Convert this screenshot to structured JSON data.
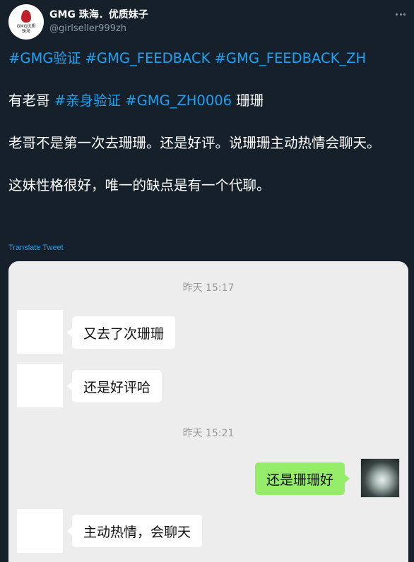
{
  "user": {
    "name": "GMG 珠海．优质妹子",
    "handle": "@girlseller999zh",
    "avatar_text": [
      "GMG优质",
      "珠海"
    ]
  },
  "tweet": {
    "hashtags_line": [
      "#GMG验证",
      "#GMG_FEEDBACK",
      "#GMG_FEEDBACK_ZH"
    ],
    "line2": {
      "prefix": "有老哥",
      "tag1": "#亲身验证",
      "tag2": "#GMG_ZH0006",
      "suffix": "珊珊"
    },
    "para2": "老哥不是第一次去珊珊。还是好评。说珊珊主动热情会聊天。",
    "para3": "这妹性格很好，唯一的缺点是有一个代聊。",
    "translate": "Translate Tweet"
  },
  "chat": {
    "timestamp1": "昨天 15:17",
    "msg1": "又去了次珊珊",
    "msg2": "还是好评哈",
    "timestamp2": "昨天 15:21",
    "msg3": "还是珊珊好",
    "msg4": "主动热情，会聊天"
  },
  "colors": {
    "background": "#15202b",
    "link": "#1da1f2",
    "chat_bg": "#ededed",
    "sent_bubble": "#95ec69"
  }
}
